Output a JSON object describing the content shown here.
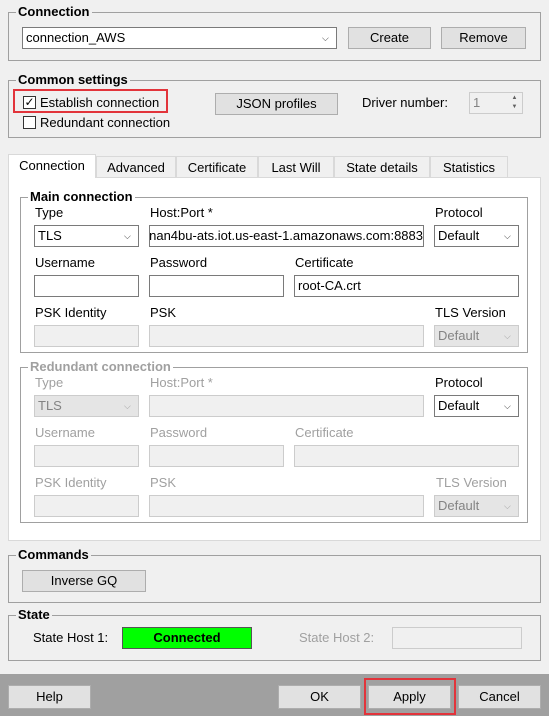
{
  "connection": {
    "group_title": "Connection",
    "selected": "connection_AWS",
    "create_label": "Create",
    "remove_label": "Remove"
  },
  "common": {
    "group_title": "Common settings",
    "establish_label": "Establish connection",
    "establish_checked": true,
    "redundant_label": "Redundant connection",
    "redundant_checked": false,
    "json_profiles_label": "JSON profiles",
    "driver_number_label": "Driver number:",
    "driver_number_value": "1"
  },
  "tabs": [
    "Connection",
    "Advanced",
    "Certificate",
    "Last Will",
    "State details",
    "Statistics"
  ],
  "main": {
    "group_title": "Main connection",
    "type_label": "Type",
    "type_value": "TLS",
    "hostport_label": "Host:Port *",
    "hostport_value": "nan4bu-ats.iot.us-east-1.amazonaws.com:8883",
    "protocol_label": "Protocol",
    "protocol_value": "Default",
    "username_label": "Username",
    "username_value": "",
    "password_label": "Password",
    "password_value": "",
    "certificate_label": "Certificate",
    "certificate_value": "root-CA.crt",
    "psk_identity_label": "PSK Identity",
    "psk_label": "PSK",
    "tls_version_label": "TLS Version",
    "tls_version_value": "Default"
  },
  "redundant": {
    "group_title": "Redundant connection",
    "type_label": "Type",
    "type_value": "TLS",
    "hostport_label": "Host:Port *",
    "protocol_label": "Protocol",
    "protocol_value": "Default",
    "username_label": "Username",
    "password_label": "Password",
    "certificate_label": "Certificate",
    "psk_identity_label": "PSK Identity",
    "psk_label": "PSK",
    "tls_version_label": "TLS Version",
    "tls_version_value": "Default"
  },
  "commands": {
    "group_title": "Commands",
    "inverse_gq_label": "Inverse GQ"
  },
  "state": {
    "group_title": "State",
    "host1_label": "State Host 1:",
    "host1_value": "Connected",
    "host1_color": "#00ff00",
    "host2_label": "State Host 2:",
    "host2_value": ""
  },
  "footer": {
    "help_label": "Help",
    "ok_label": "OK",
    "apply_label": "Apply",
    "cancel_label": "Cancel"
  },
  "icons": {
    "dropdown": "chevron-down-icon",
    "spin": "spin-arrows-icon",
    "check": "checkmark-icon"
  },
  "highlight_color": "#e2343b"
}
